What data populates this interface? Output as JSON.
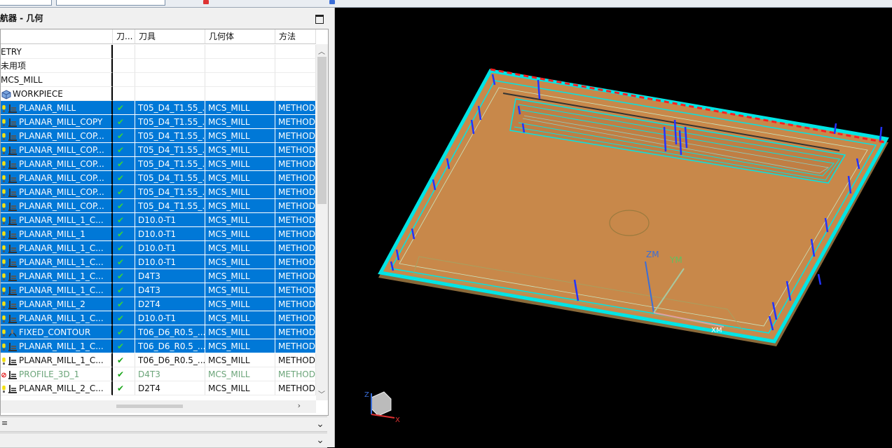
{
  "nav": {
    "title": "航器 - 几何"
  },
  "columns": [
    "刀...",
    "刀具",
    "几何体",
    "方法"
  ],
  "rows": [
    {
      "name": "ETRY",
      "check": "",
      "tool": "",
      "geom": "",
      "method": "",
      "icon": "none",
      "sel": false,
      "indent": 0
    },
    {
      "name": "未用项",
      "check": "",
      "tool": "",
      "geom": "",
      "method": "",
      "icon": "none",
      "sel": false,
      "indent": 0
    },
    {
      "name": "MCS_MILL",
      "check": "",
      "tool": "",
      "geom": "",
      "method": "",
      "icon": "none",
      "sel": false,
      "indent": 0
    },
    {
      "name": "WORKPIECE",
      "check": "",
      "tool": "",
      "geom": "",
      "method": "",
      "icon": "workpiece",
      "sel": false,
      "indent": 0
    },
    {
      "name": "PLANAR_MILL",
      "check": "✔",
      "tool": "T05_D4_T1.55_...",
      "geom": "MCS_MILL",
      "method": "METHOD",
      "icon": "op",
      "sel": true
    },
    {
      "name": "PLANAR_MILL_COPY",
      "check": "✔",
      "tool": "T05_D4_T1.55_...",
      "geom": "MCS_MILL",
      "method": "METHOD",
      "icon": "op",
      "sel": true
    },
    {
      "name": "PLANAR_MILL_COP...",
      "check": "✔",
      "tool": "T05_D4_T1.55_...",
      "geom": "MCS_MILL",
      "method": "METHOD",
      "icon": "op",
      "sel": true
    },
    {
      "name": "PLANAR_MILL_COP...",
      "check": "✔",
      "tool": "T05_D4_T1.55_...",
      "geom": "MCS_MILL",
      "method": "METHOD",
      "icon": "op",
      "sel": true
    },
    {
      "name": "PLANAR_MILL_COP...",
      "check": "✔",
      "tool": "T05_D4_T1.55_...",
      "geom": "MCS_MILL",
      "method": "METHOD",
      "icon": "op",
      "sel": true
    },
    {
      "name": "PLANAR_MILL_COP...",
      "check": "✔",
      "tool": "T05_D4_T1.55_...",
      "geom": "MCS_MILL",
      "method": "METHOD",
      "icon": "op",
      "sel": true
    },
    {
      "name": "PLANAR_MILL_COP...",
      "check": "✔",
      "tool": "T05_D4_T1.55_...",
      "geom": "MCS_MILL",
      "method": "METHOD",
      "icon": "op",
      "sel": true
    },
    {
      "name": "PLANAR_MILL_COP...",
      "check": "✔",
      "tool": "T05_D4_T1.55_...",
      "geom": "MCS_MILL",
      "method": "METHOD",
      "icon": "op",
      "sel": true
    },
    {
      "name": "PLANAR_MILL_1_C...",
      "check": "✔",
      "tool": "D10.0-T1",
      "geom": "MCS_MILL",
      "method": "METHOD",
      "icon": "op",
      "sel": true
    },
    {
      "name": "PLANAR_MILL_1",
      "check": "✔",
      "tool": "D10.0-T1",
      "geom": "MCS_MILL",
      "method": "METHOD",
      "icon": "op",
      "sel": true
    },
    {
      "name": "PLANAR_MILL_1_C...",
      "check": "✔",
      "tool": "D10.0-T1",
      "geom": "MCS_MILL",
      "method": "METHOD",
      "icon": "op",
      "sel": true
    },
    {
      "name": "PLANAR_MILL_1_C...",
      "check": "✔",
      "tool": "D10.0-T1",
      "geom": "MCS_MILL",
      "method": "METHOD",
      "icon": "op",
      "sel": true
    },
    {
      "name": "PLANAR_MILL_1_C...",
      "check": "✔",
      "tool": "D4T3",
      "geom": "MCS_MILL",
      "method": "METHOD",
      "icon": "op",
      "sel": true
    },
    {
      "name": "PLANAR_MILL_1_C...",
      "check": "✔",
      "tool": "D4T3",
      "geom": "MCS_MILL",
      "method": "METHOD",
      "icon": "op",
      "sel": true
    },
    {
      "name": "PLANAR_MILL_2",
      "check": "✔",
      "tool": "D2T4",
      "geom": "MCS_MILL",
      "method": "METHOD",
      "icon": "op",
      "sel": true
    },
    {
      "name": "PLANAR_MILL_1_C...",
      "check": "✔",
      "tool": "D10.0-T1",
      "geom": "MCS_MILL",
      "method": "METHOD",
      "icon": "op",
      "sel": true
    },
    {
      "name": "FIXED_CONTOUR",
      "check": "✔",
      "tool": "T06_D6_R0.5_...",
      "geom": "MCS_MILL",
      "method": "METHOD",
      "icon": "contour",
      "sel": true
    },
    {
      "name": "PLANAR_MILL_1_C...",
      "check": "✔",
      "tool": "T06_D6_R0.5_...",
      "geom": "MCS_MILL",
      "method": "METHOD",
      "icon": "op",
      "sel": true
    },
    {
      "name": "PLANAR_MILL_1_C...",
      "check": "✔",
      "tool": "T06_D6_R0.5_...",
      "geom": "MCS_MILL",
      "method": "METHOD",
      "icon": "op",
      "sel": false
    },
    {
      "name": "PROFILE_3D_1",
      "check": "✔",
      "tool": "D4T3",
      "geom": "MCS_MILL",
      "method": "METHOD",
      "icon": "op",
      "sel": false,
      "disabled": true
    },
    {
      "name": "PLANAR_MILL_2_C...",
      "check": "✔",
      "tool": "D2T4",
      "geom": "MCS_MILL",
      "method": "METHOD",
      "icon": "op",
      "sel": false
    }
  ],
  "sections": [
    {
      "label": "≡"
    },
    {
      "label": ""
    }
  ],
  "viewport": {
    "axis_labels": {
      "zm": "ZM",
      "ym": "YM",
      "xm": "XM",
      "triad_z": "Z",
      "triad_x": "X"
    },
    "colors": {
      "toolpath": "#00e5e5",
      "part": "#c8884a",
      "rapid": "#ff2020",
      "approach": "#2233ff"
    }
  }
}
